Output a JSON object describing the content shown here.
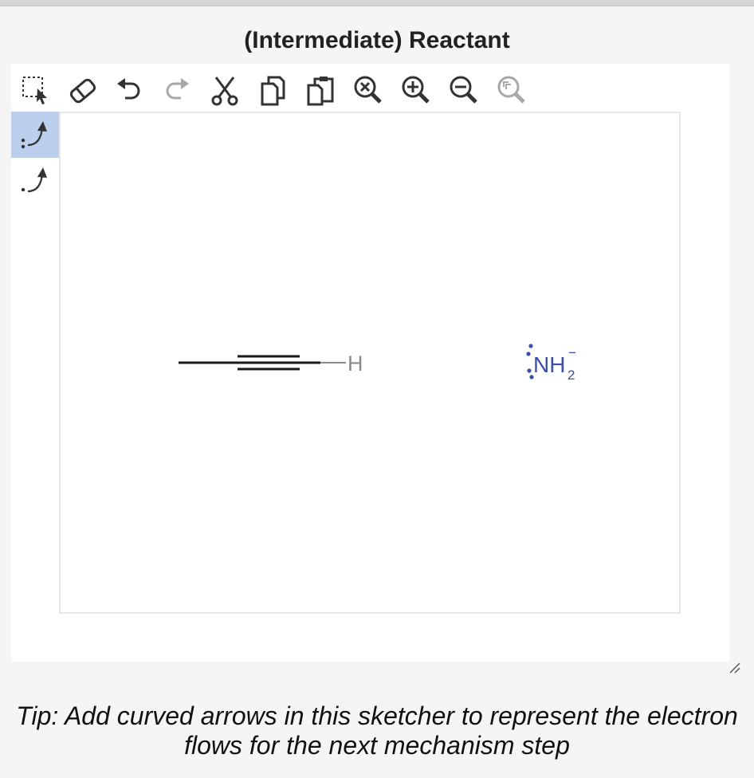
{
  "panel": {
    "title": "(Intermediate) Reactant"
  },
  "toolbar": {
    "tools": [
      {
        "name": "select-icon"
      },
      {
        "name": "eraser-icon"
      },
      {
        "name": "undo-icon"
      },
      {
        "name": "redo-icon"
      },
      {
        "name": "cut-icon"
      },
      {
        "name": "copy-icon"
      },
      {
        "name": "paste-icon"
      },
      {
        "name": "zoom-clear-icon"
      },
      {
        "name": "zoom-in-icon"
      },
      {
        "name": "zoom-out-icon"
      },
      {
        "name": "zoom-fit-icon"
      }
    ]
  },
  "sidebar": {
    "tools": [
      {
        "name": "electron-pair-arrow-icon",
        "active": true
      },
      {
        "name": "single-electron-arrow-icon",
        "active": false
      }
    ]
  },
  "molecules": {
    "alkyne_atom_h": "H",
    "amide_label": "NH",
    "amide_subscript": "2",
    "amide_charge": "−"
  },
  "colors": {
    "active_tool": "#bcd0ee",
    "amide": "#3a4fa8",
    "bond": "#1a1a1a",
    "disabled": "#a8a8a8"
  },
  "tip": {
    "line1": "Tip: Add curved arrows in this sketcher to represent the electron",
    "line2": "flows for the next mechanism step"
  }
}
